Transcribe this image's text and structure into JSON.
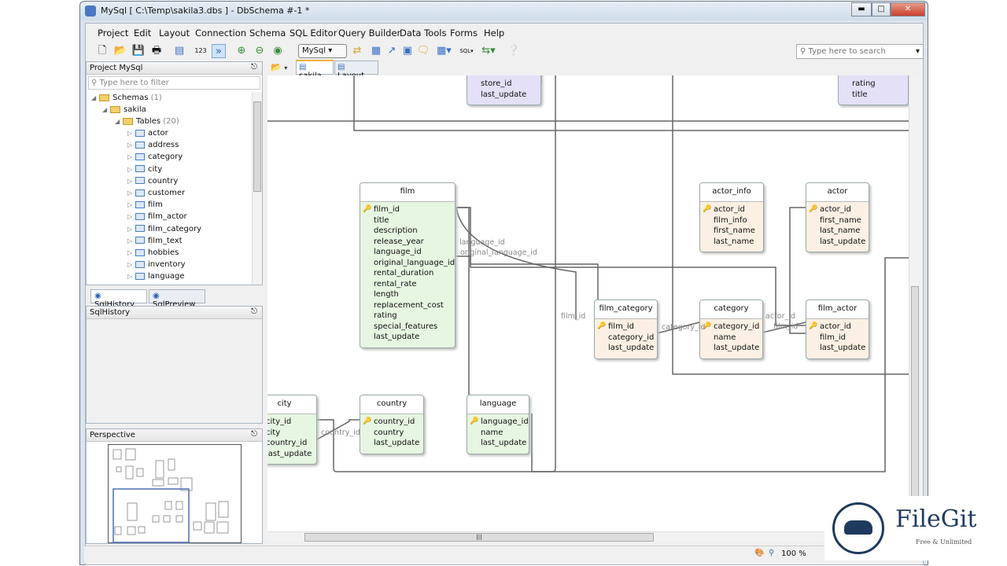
{
  "window": {
    "title": "MySql [ C:\\Temp\\sakila3.dbs ] - DbSchema #-1 *"
  },
  "menu": [
    "Project",
    "Edit",
    "Layout",
    "Connection",
    "Schema",
    "SQL Editor",
    "Query Builder",
    "Data Tools",
    "Forms",
    "Help"
  ],
  "toolbar": {
    "db_select": "MySql",
    "search_placeholder": "Type here to search"
  },
  "project": {
    "title": "Project MySql",
    "filter_placeholder": "Type here to filter",
    "tree": {
      "schemas": "Schemas",
      "schemas_count": "(1)",
      "schema": "sakila",
      "tables": "Tables",
      "tables_count": "(20)",
      "items": [
        "actor",
        "address",
        "category",
        "city",
        "country",
        "customer",
        "film",
        "film_actor",
        "film_category",
        "film_text",
        "hobbies",
        "inventory",
        "language"
      ]
    }
  },
  "bottom_tabs": [
    "SqlHistory",
    "SqlPreview"
  ],
  "sqlhistory": {
    "title": "SqlHistory"
  },
  "perspective": {
    "title": "Perspective"
  },
  "layout_tabs": [
    "sakila",
    "Layout_"
  ],
  "tables": {
    "top1": {
      "columns": [
        "store_id",
        "last_update"
      ]
    },
    "top2": {
      "columns": [
        "rating",
        "title"
      ]
    },
    "film": {
      "name": "film",
      "columns": [
        "film_id",
        "title",
        "description",
        "release_year",
        "language_id",
        "original_language_id",
        "rental_duration",
        "rental_rate",
        "length",
        "replacement_cost",
        "rating",
        "special_features",
        "last_update"
      ]
    },
    "actor_info": {
      "name": "actor_info",
      "columns": [
        "actor_id",
        "film_info",
        "first_name",
        "last_name"
      ]
    },
    "actor": {
      "name": "actor",
      "columns": [
        "actor_id",
        "first_name",
        "last_name",
        "last_update"
      ]
    },
    "film_category": {
      "name": "film_category",
      "columns": [
        "film_id",
        "category_id",
        "last_update"
      ]
    },
    "category": {
      "name": "category",
      "columns": [
        "category_id",
        "name",
        "last_update"
      ]
    },
    "film_actor": {
      "name": "film_actor",
      "columns": [
        "actor_id",
        "film_id",
        "last_update"
      ]
    },
    "city": {
      "name": "city",
      "columns": [
        "city_id",
        "city",
        "country_id",
        "last_update"
      ]
    },
    "country": {
      "name": "country",
      "columns": [
        "country_id",
        "country",
        "last_update"
      ]
    },
    "language": {
      "name": "language",
      "columns": [
        "language_id",
        "name",
        "last_update"
      ]
    }
  },
  "fk_labels": [
    "language_id",
    "original_language_id",
    "film_id",
    "category_id",
    "actor_id",
    "film_id",
    "country_id"
  ],
  "status": {
    "zoom": "100 %"
  },
  "watermark": {
    "brand": "FileGit",
    "tagline": "Free & Unlimited"
  }
}
